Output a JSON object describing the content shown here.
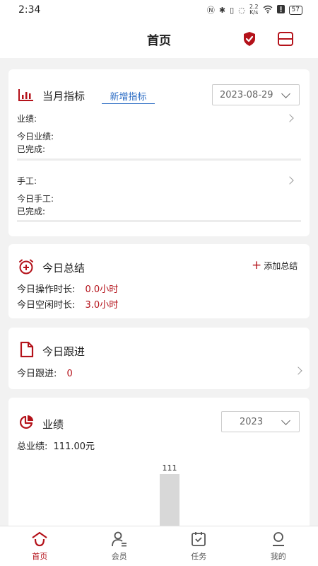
{
  "status": {
    "time": "2:34",
    "network_speed_top": "2.2",
    "network_speed_bottom": "K/s",
    "battery": "57"
  },
  "header": {
    "title": "首页"
  },
  "metrics": {
    "title": "当月指标",
    "add_link": "新增指标",
    "date": "2023-08-29",
    "performance_label": "业绩:",
    "today_performance_label": "今日业绩:",
    "performance_completed_label": "已完成:",
    "manual_label": "手工:",
    "today_manual_label": "今日手工:",
    "manual_completed_label": "已完成:"
  },
  "summary": {
    "title": "今日总结",
    "add_label": "添加总结",
    "op_time_label": "今日操作时长:",
    "op_time_value": "0.0小时",
    "idle_time_label": "今日空闲时长:",
    "idle_time_value": "3.0小时"
  },
  "followup": {
    "title": "今日跟进",
    "count_label": "今日跟进:",
    "count_value": "0"
  },
  "sales": {
    "title": "业绩",
    "year": "2023",
    "total_label": "总业绩:",
    "total_value": "111.00元",
    "bar_label": "111"
  },
  "chart_data": {
    "type": "bar",
    "categories": [
      ""
    ],
    "values": [
      111
    ],
    "title": "",
    "xlabel": "",
    "ylabel": ""
  },
  "tabs": [
    {
      "label": "首页",
      "icon": "home-icon",
      "active": true
    },
    {
      "label": "会员",
      "icon": "member-icon",
      "active": false
    },
    {
      "label": "任务",
      "icon": "task-icon",
      "active": false
    },
    {
      "label": "我的",
      "icon": "profile-icon",
      "active": false
    }
  ],
  "colors": {
    "accent": "#b4121a",
    "link": "#2b6cc4",
    "background": "#f2f2f2"
  }
}
